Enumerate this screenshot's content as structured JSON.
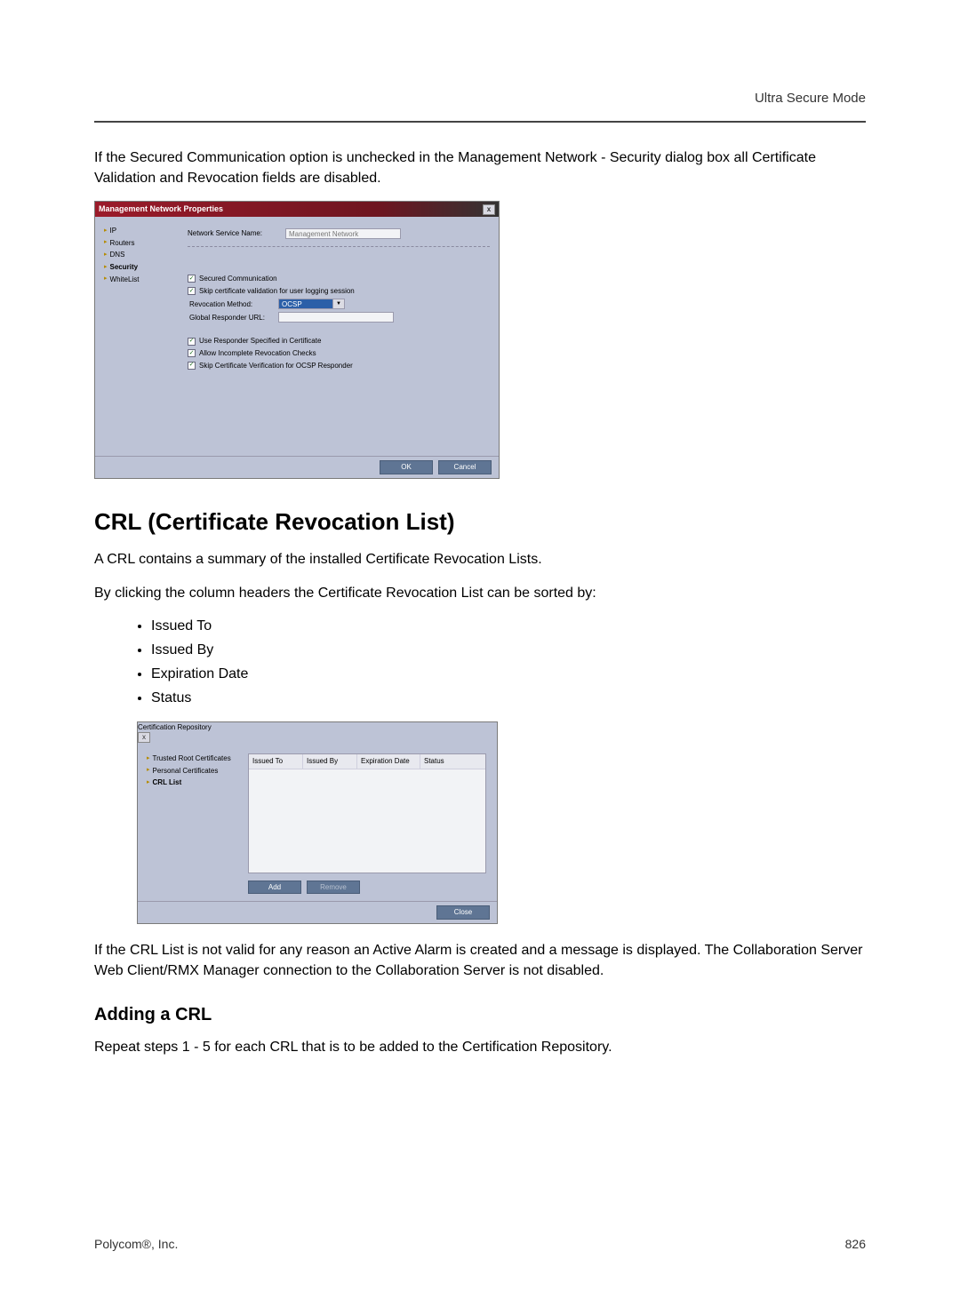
{
  "header": {
    "section_label": "Ultra Secure Mode"
  },
  "intro_paragraph": "If the Secured Communication option is unchecked in the Management Network - Security dialog box all Certificate Validation and Revocation fields are disabled.",
  "dialog1": {
    "title": "Management Network Properties",
    "close": "x",
    "nav": [
      {
        "label": "IP"
      },
      {
        "label": "Routers"
      },
      {
        "label": "DNS"
      },
      {
        "label": "Security",
        "selected": true
      },
      {
        "label": "WhiteList"
      }
    ],
    "service_name_label": "Network Service Name:",
    "service_name_value": "Management Network",
    "chk_secured": "Secured Communication",
    "chk_skip_validation": "Skip certificate validation for user logging session",
    "revocation_method_label": "Revocation Method:",
    "revocation_method_value": "OCSP",
    "global_responder_label": "Global Responder URL:",
    "global_responder_value": "",
    "chk_use_responder": "Use Responder Specified in Certificate",
    "chk_allow_incomplete": "Allow Incomplete Revocation Checks",
    "chk_skip_verification": "Skip Certificate Verification for OCSP Responder",
    "ok": "OK",
    "cancel": "Cancel"
  },
  "section1": {
    "heading": "CRL (Certificate Revocation List)",
    "p1": "A CRL contains a summary of the installed Certificate Revocation Lists.",
    "p2": "By clicking the column headers the Certificate Revocation List can be sorted by:",
    "bullets": [
      "Issued To",
      "Issued By",
      "Expiration Date",
      "Status"
    ]
  },
  "dialog2": {
    "title": "Certification Repository",
    "close": "x",
    "nav": [
      {
        "label": "Trusted Root Certificates"
      },
      {
        "label": "Personal Certificates"
      },
      {
        "label": "CRL List",
        "selected": true
      }
    ],
    "columns": [
      "Issued To",
      "Issued By",
      "Expiration Date",
      "Status"
    ],
    "add": "Add",
    "remove": "Remove",
    "close_btn": "Close"
  },
  "after_dialog2": "If the CRL List is not valid for any reason an Active Alarm is created and a message is displayed. The Collaboration Server Web Client/RMX Manager connection to the Collaboration Server is not disabled.",
  "section2": {
    "heading": "Adding a CRL",
    "p1": "Repeat steps 1 - 5 for each CRL that is to be added to the Certification Repository."
  },
  "footer": {
    "left": "Polycom®, Inc.",
    "right": "826"
  }
}
